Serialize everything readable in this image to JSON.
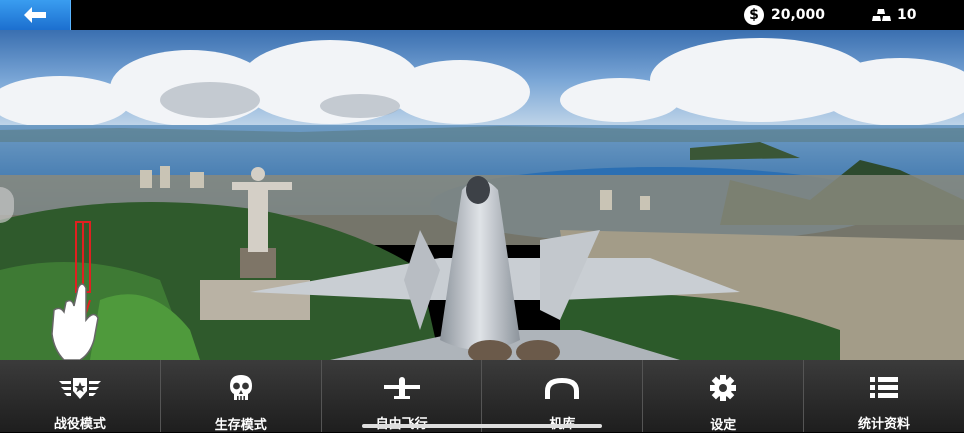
{
  "topbar": {
    "back_icon": "arrow-left-icon",
    "coins": {
      "icon": "dollar-coin-icon",
      "symbol": "$",
      "value": "20,000"
    },
    "gold": {
      "icon": "gold-bars-icon",
      "value": "10"
    }
  },
  "colors": {
    "back_button": "#2a86e3",
    "nav_bg": "#2e2e2e",
    "tutorial_arrow": "#e02020"
  },
  "nav": [
    {
      "label": "战役模式",
      "icon": "winged-star-badge-icon"
    },
    {
      "label": "生存模式",
      "icon": "skull-icon"
    },
    {
      "label": "自由飞行",
      "icon": "airplane-icon"
    },
    {
      "label": "机库",
      "icon": "hangar-icon"
    },
    {
      "label": "设定",
      "icon": "gear-icon"
    },
    {
      "label": "统计资料",
      "icon": "list-icon"
    }
  ]
}
